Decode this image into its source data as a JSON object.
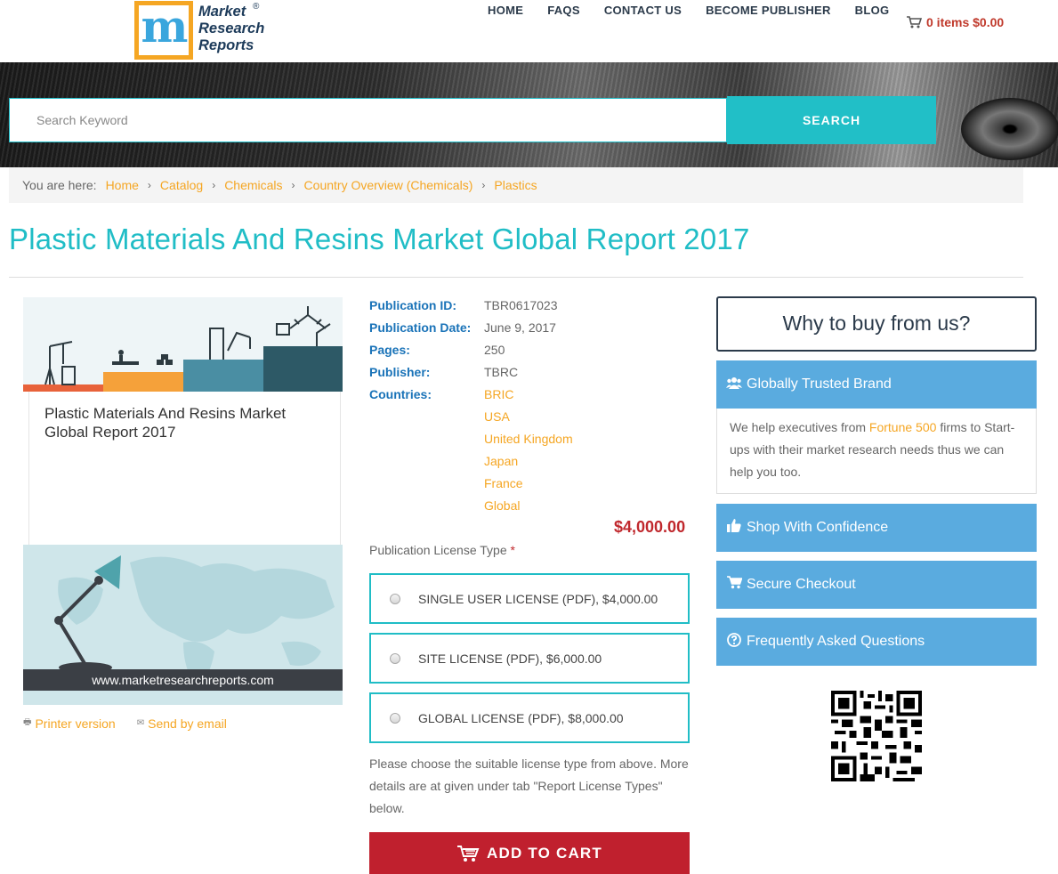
{
  "brand": {
    "logo_lines": [
      "Market",
      "Research",
      "Reports"
    ],
    "registered": "®"
  },
  "nav": [
    "HOME",
    "FAQS",
    "CONTACT US",
    "BECOME PUBLISHER",
    "BLOG"
  ],
  "cart": {
    "summary": "0 items $0.00"
  },
  "search": {
    "placeholder": "Search Keyword",
    "button": "SEARCH"
  },
  "breadcrumb": {
    "label": "You are here:",
    "items": [
      "Home",
      "Catalog",
      "Chemicals",
      "Country Overview (Chemicals)",
      "Plastics"
    ]
  },
  "page_title": "Plastic Materials And Resins Market Global Report 2017",
  "product_image": {
    "title": "Plastic Materials And Resins Market Global Report 2017",
    "url": "www.marketresearchreports.com"
  },
  "links": {
    "printer": "Printer version",
    "email": "Send by email"
  },
  "details": {
    "publication_id_label": "Publication ID:",
    "publication_id": "TBR0617023",
    "publication_date_label": "Publication Date:",
    "publication_date": "June 9, 2017",
    "pages_label": "Pages:",
    "pages": "250",
    "publisher_label": "Publisher:",
    "publisher": "TBRC",
    "countries_label": "Countries:",
    "countries": [
      "BRIC",
      "USA",
      "United Kingdom",
      "Japan",
      "France",
      "Global"
    ]
  },
  "price": "$4,000.00",
  "license": {
    "label": "Publication License Type",
    "required_mark": "*",
    "options": [
      "SINGLE USER LICENSE (PDF), $4,000.00",
      "SITE LICENSE (PDF), $6,000.00",
      "GLOBAL LICENSE (PDF), $8,000.00"
    ],
    "note": "Please choose the suitable license type from above. More details are at given under tab \"Report License Types\" below."
  },
  "add_to_cart": "ADD TO CART",
  "sidebar": {
    "why_title": "Why to buy from us?",
    "trusted": "Globally Trusted Brand",
    "trusted_text_before": "We help executives from",
    "trusted_text_highlight": "Fortune 500",
    "trusted_text_after": "firms to Start-ups with their market research needs thus we can help you too.",
    "shop": "Shop With Confidence",
    "secure": "Secure Checkout",
    "faq": "Frequently Asked Questions"
  },
  "colors": {
    "accent_teal": "#20bdc6",
    "link_orange": "#f5a623",
    "price_red": "#c0282d",
    "sidebar_blue": "#5aabdf",
    "label_blue": "#1a73b8"
  }
}
